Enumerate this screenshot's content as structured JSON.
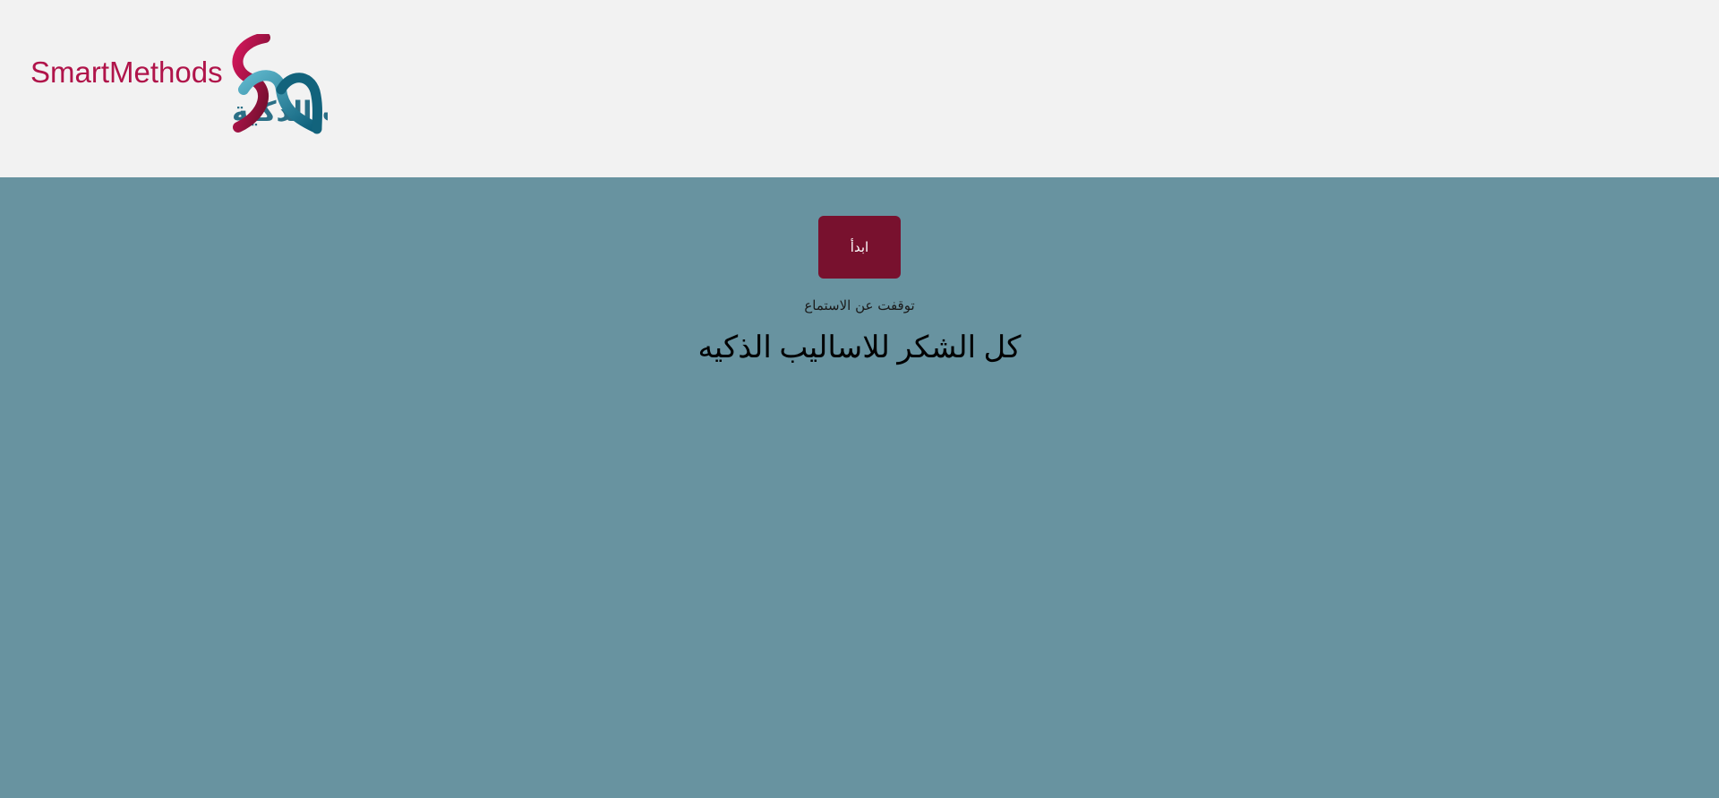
{
  "header": {
    "logo": {
      "text_en": "SmartMethods",
      "text_ar": "الأساليب الذكية",
      "colors": {
        "teal": "#2a6f86",
        "magenta": "#b0144a",
        "maroon": "#78112e"
      }
    }
  },
  "main": {
    "start_button_label": "ابدأ",
    "status_text": "توقفت عن الاستماع",
    "transcript_text": "كل الشكر للاساليب الذكيه"
  },
  "colors": {
    "header_bg": "#f2f2f2",
    "page_bg": "#6893a0",
    "button_bg": "#78112e"
  }
}
